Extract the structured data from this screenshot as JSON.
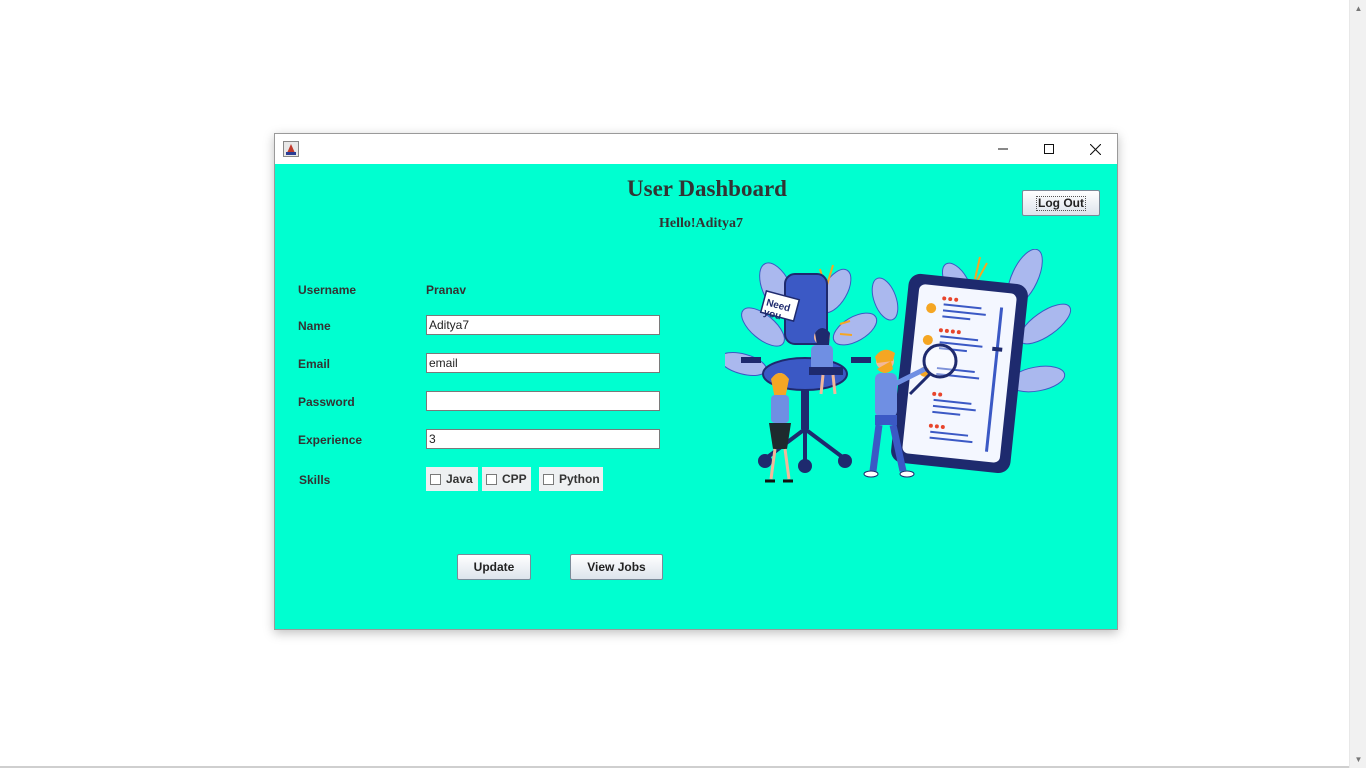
{
  "window": {
    "icon": "java-app-icon",
    "controls": {
      "minimize": "minimize-icon",
      "maximize": "maximize-icon",
      "close": "close-icon"
    }
  },
  "dashboard": {
    "title": "User Dashboard",
    "greeting": "Hello!Aditya7",
    "logout_label": "Log Out"
  },
  "form": {
    "username_label": "Username",
    "username_value": "Pranav",
    "name_label": "Name",
    "name_value": "Aditya7",
    "email_label": "Email",
    "email_value": "email",
    "password_label": "Password",
    "password_value": "",
    "experience_label": "Experience",
    "experience_value": "3",
    "skills_label": "Skills",
    "skills": [
      {
        "label": "Java",
        "checked": false
      },
      {
        "label": "CPP",
        "checked": false
      },
      {
        "label": "Python",
        "checked": false
      }
    ]
  },
  "actions": {
    "update_label": "Update",
    "view_jobs_label": "View Jobs"
  },
  "illustration": {
    "sign_text": "Need you",
    "icon": "recruitment-illustration"
  },
  "colors": {
    "background": "#00ffd0",
    "text": "#333333",
    "navy": "#1e2a6e",
    "blue": "#3b59c5",
    "leaf": "#aab8ee",
    "accent": "#f5a623"
  }
}
